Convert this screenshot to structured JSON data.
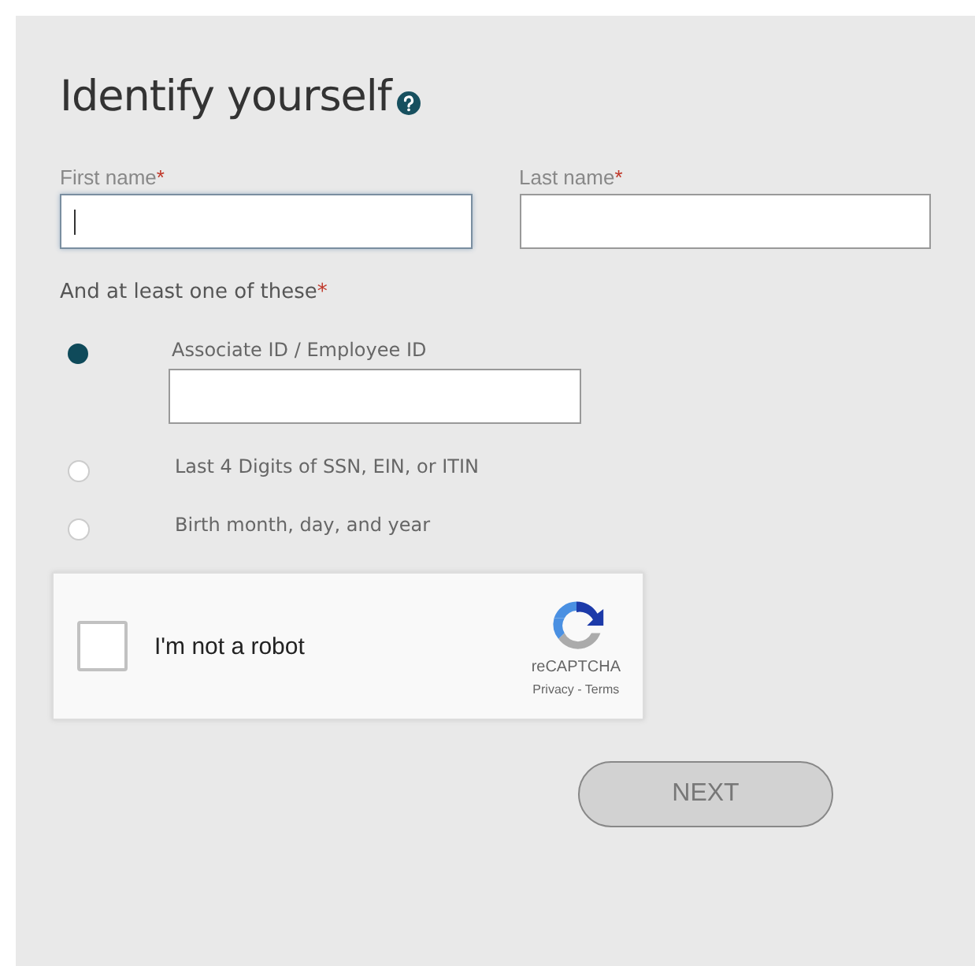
{
  "title": "Identify yourself",
  "name_fields": [
    {
      "label": "First name",
      "required_mark": "*",
      "focused": true
    },
    {
      "label": "Last name",
      "required_mark": "*",
      "focused": false
    }
  ],
  "options_heading": {
    "text": "And at least one of these",
    "required_mark": "*"
  },
  "options": [
    {
      "label": "Associate ID / Employee ID",
      "selected": true
    },
    {
      "label": "Last 4 Digits of SSN, EIN, or ITIN",
      "selected": false
    },
    {
      "label": "Birth month, day, and year",
      "selected": false
    }
  ],
  "captcha": {
    "label": "I'm not a robot",
    "checked": false,
    "brand": "reCAPTCHA",
    "links": "Privacy - Terms"
  },
  "next_button": {
    "label": "NEXT",
    "disabled": true
  }
}
